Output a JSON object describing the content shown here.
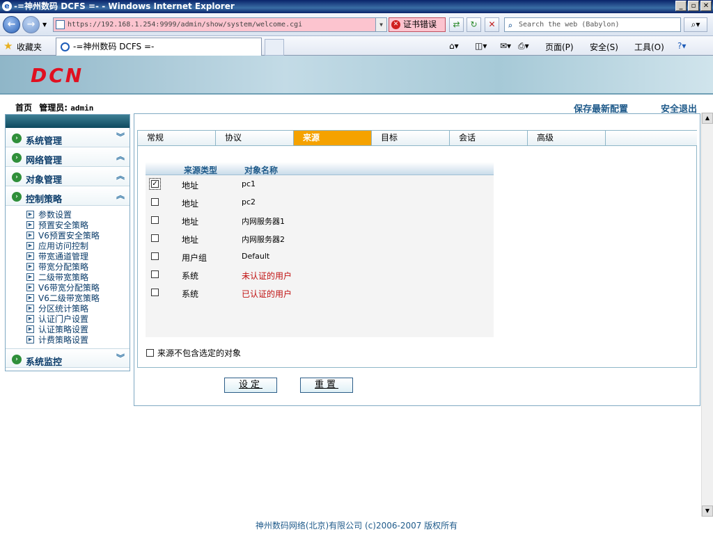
{
  "window": {
    "title": "-=神州数码 DCFS =- - Windows Internet Explorer"
  },
  "browser": {
    "address": "https://192.168.1.254:9999/admin/show/system/welcome.cgi",
    "cert_error": "证书错误",
    "search_placeholder": "Search the web (Babylon)",
    "favorites": "收藏夹",
    "tab_title": "-=神州数码 DCFS =-",
    "menu_page": "页面(P)",
    "menu_safety": "安全(S)",
    "menu_tools": "工具(O)"
  },
  "app": {
    "logo": "DCN",
    "breadcrumb_home": "首页",
    "admin_label": "管理员:",
    "admin_user": "admin",
    "save_config": "保存最新配置",
    "logout": "安全退出"
  },
  "sidebar": {
    "sections": [
      {
        "label": "系统管理"
      },
      {
        "label": "网络管理"
      },
      {
        "label": "对象管理"
      },
      {
        "label": "控制策略"
      }
    ],
    "items": [
      {
        "label": "参数设置"
      },
      {
        "label": "预置安全策略"
      },
      {
        "label": "V6预置安全策略"
      },
      {
        "label": "应用访问控制"
      },
      {
        "label": "带宽通道管理"
      },
      {
        "label": "带宽分配策略"
      },
      {
        "label": "二级带宽策略"
      },
      {
        "label": "V6带宽分配策略"
      },
      {
        "label": "V6二级带宽策略"
      },
      {
        "label": "分区统计策略"
      },
      {
        "label": "认证门户设置"
      },
      {
        "label": "认证策略设置"
      },
      {
        "label": "计费策略设置"
      }
    ],
    "last_section": "系统监控"
  },
  "tabs": [
    {
      "label": "常规"
    },
    {
      "label": "协议"
    },
    {
      "label": "来源"
    },
    {
      "label": "目标"
    },
    {
      "label": "会话"
    },
    {
      "label": "高级"
    }
  ],
  "table": {
    "col_type": "来源类型",
    "col_name": "对象名称",
    "rows": [
      {
        "type": "地址",
        "name": "pc1",
        "checked": true
      },
      {
        "type": "地址",
        "name": "pc2",
        "checked": false
      },
      {
        "type": "地址",
        "name": "内网服务器1",
        "checked": false
      },
      {
        "type": "地址",
        "name": "内网服务器2",
        "checked": false
      },
      {
        "type": "用户组",
        "name": "Default",
        "checked": false
      },
      {
        "type": "系统",
        "name": "未认证的用户",
        "checked": false
      },
      {
        "type": "系统",
        "name": "已认证的用户",
        "checked": false
      }
    ]
  },
  "exclude_label": "来源不包含选定的对象",
  "buttons": {
    "submit": "设定",
    "reset": "重置"
  },
  "footer": "神州数码网络(北京)有限公司 (c)2006-2007 版权所有"
}
